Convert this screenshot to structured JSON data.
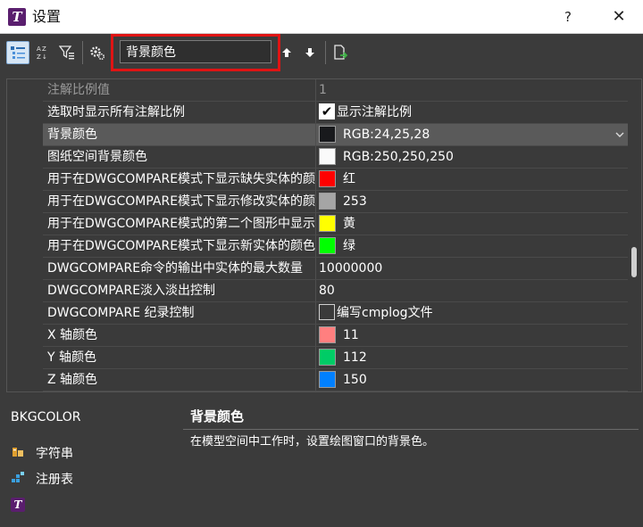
{
  "window": {
    "title": "设置",
    "app_icon_letter": "T",
    "help_label": "?",
    "close_label": "✕"
  },
  "toolbar": {
    "search_value": "背景颜色",
    "buttons": [
      "categorized-view-icon",
      "alphabetical-sort-icon",
      "filter-icon",
      "settings-gear-icon",
      "find-next-icon",
      "find-previous-icon",
      "export-icon"
    ]
  },
  "grid": {
    "rows": [
      {
        "name": "注解比例值",
        "value": "1",
        "muted": true
      },
      {
        "name": "选取时显示所有注解比例",
        "value": "显示注解比例",
        "checkbox": true,
        "checked": true
      },
      {
        "name": "背景颜色",
        "value": "RGB:24,25,28",
        "swatch": "#18191c",
        "selected": true,
        "dropdown": true
      },
      {
        "name": "图纸空间背景颜色",
        "value": "RGB:250,250,250",
        "swatch": "#fafafa"
      },
      {
        "name": "用于在DWGCOMPARE模式下显示缺失实体的颜色",
        "value": "红",
        "swatch": "#ff0000"
      },
      {
        "name": "用于在DWGCOMPARE模式下显示修改实体的颜色",
        "value": "253",
        "swatch": "#a5a5a5"
      },
      {
        "name": "用于在DWGCOMPARE模式的第二个图形中显示",
        "value": "黄",
        "swatch": "#ffff00"
      },
      {
        "name": "用于在DWGCOMPARE模式下显示新实体的颜色",
        "value": "绿",
        "swatch": "#00ff00"
      },
      {
        "name": "DWGCOMPARE命令的输出中实体的最大数量",
        "value": "10000000"
      },
      {
        "name": "DWGCOMPARE淡入淡出控制",
        "value": "80"
      },
      {
        "name": "DWGCOMPARE 纪录控制",
        "value": "编写cmplog文件",
        "checkbox": true,
        "checked": false
      },
      {
        "name": "X 轴颜色",
        "value": "11",
        "swatch": "#ff7f7f"
      },
      {
        "name": "Y 轴颜色",
        "value": "112",
        "swatch": "#00cc66"
      },
      {
        "name": "Z 轴颜色",
        "value": "150",
        "swatch": "#0080ff"
      }
    ]
  },
  "details": {
    "variable_name": "BKGCOLOR",
    "title": "背景颜色",
    "description": "在模型空间中工作时，设置绘图窗口的背景色。"
  },
  "sidebar": {
    "items": [
      {
        "label": "字符串",
        "icon": "string-type-icon"
      },
      {
        "label": "注册表",
        "icon": "registry-icon"
      }
    ]
  }
}
